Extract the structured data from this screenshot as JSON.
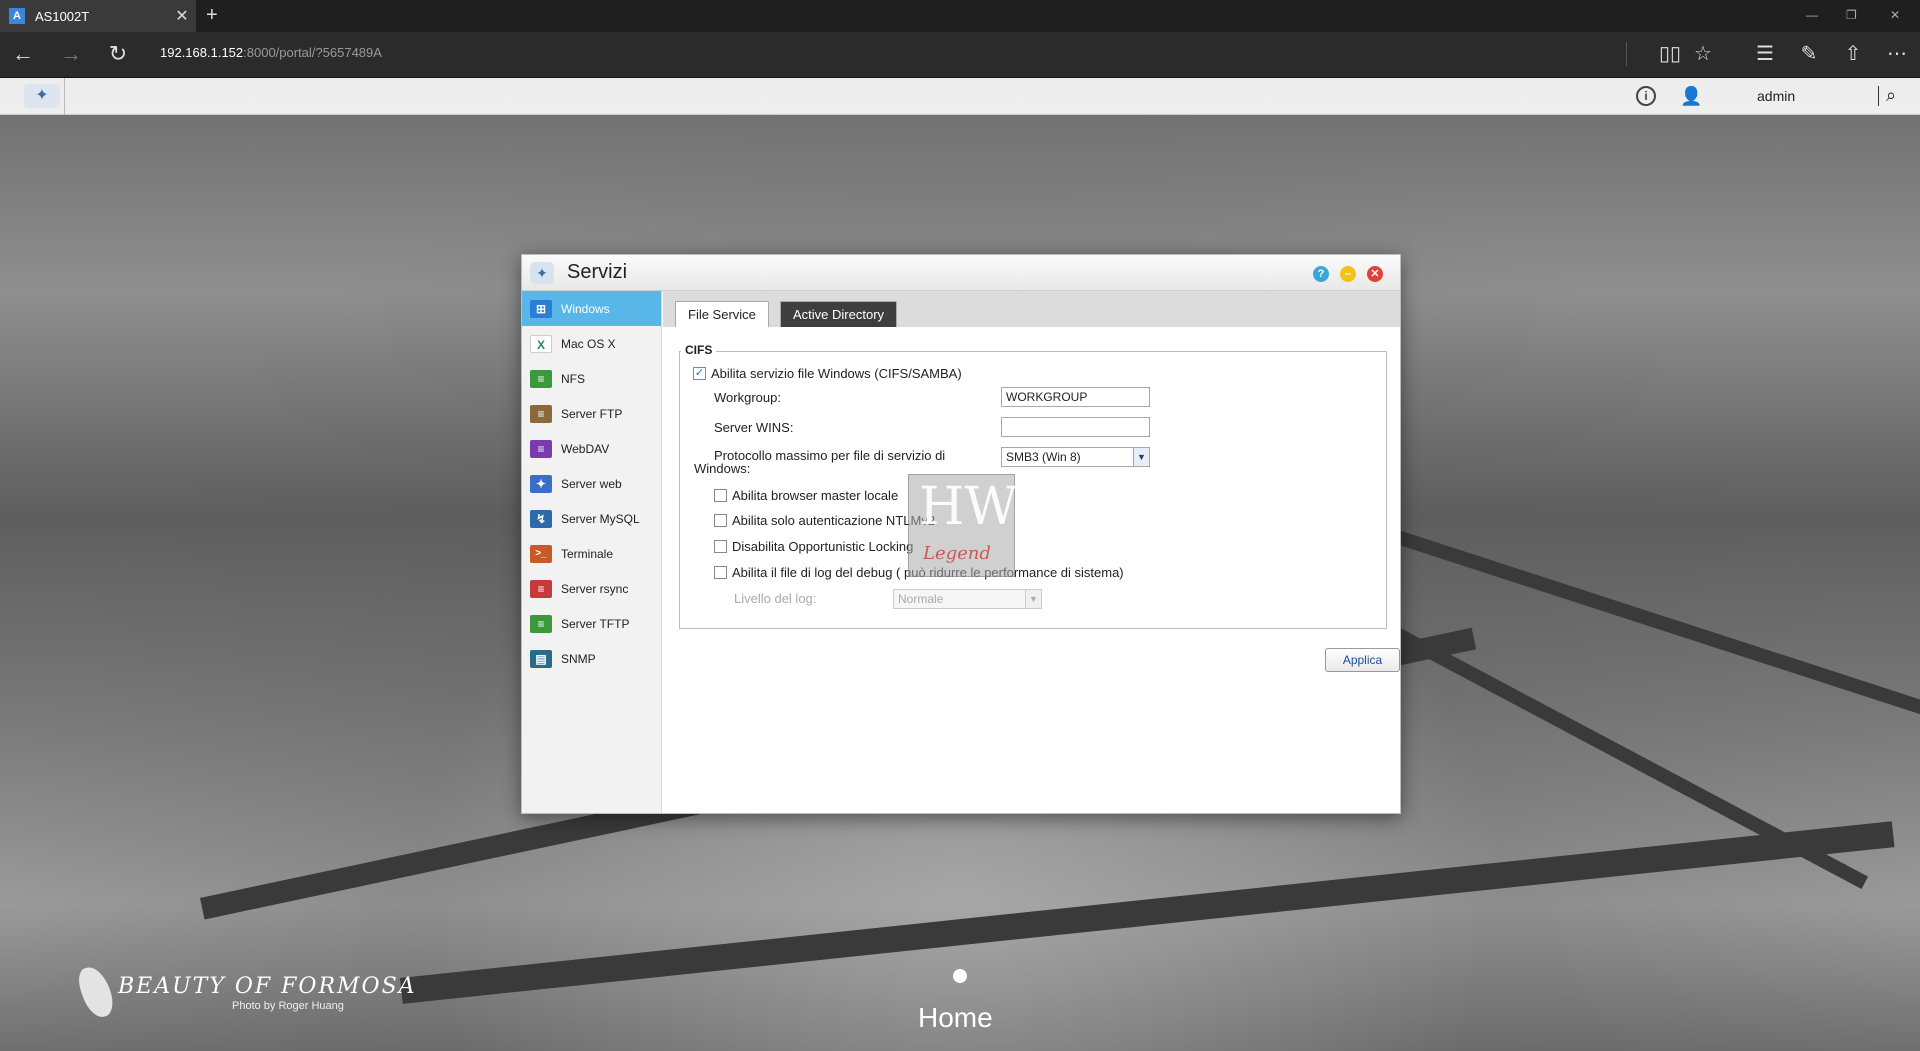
{
  "browser": {
    "tab_title": "AS1002T",
    "favicon_letter": "A",
    "url_host": "192.168.1.152",
    "url_rest": ":8000/portal/?5657489A"
  },
  "appbar": {
    "user_name": "admin"
  },
  "window": {
    "title": "Servizi",
    "sidebar": [
      {
        "label": "Windows",
        "icon": "windows-icon",
        "color": "#2a7fd4",
        "glyph": "⊞"
      },
      {
        "label": "Mac OS X",
        "icon": "macos-icon",
        "color": "#ffffff",
        "glyph": "X"
      },
      {
        "label": "NFS",
        "icon": "nfs-icon",
        "color": "#3a9a3a",
        "glyph": "≡"
      },
      {
        "label": "Server FTP",
        "icon": "ftp-icon",
        "color": "#8a6a3a",
        "glyph": "≡"
      },
      {
        "label": "WebDAV",
        "icon": "webdav-icon",
        "color": "#7a3ab0",
        "glyph": "≡"
      },
      {
        "label": "Server web",
        "icon": "web-server-icon",
        "color": "#3a6ec8",
        "glyph": "✦"
      },
      {
        "label": "Server MySQL",
        "icon": "mysql-icon",
        "color": "#2a6aa8",
        "glyph": "↯"
      },
      {
        "label": "Terminale",
        "icon": "terminal-icon",
        "color": "#c85a2a",
        "glyph": ">_"
      },
      {
        "label": "Server rsync",
        "icon": "rsync-icon",
        "color": "#c83a3a",
        "glyph": "≡"
      },
      {
        "label": "Server TFTP",
        "icon": "tftp-icon",
        "color": "#3a9a3a",
        "glyph": "≡"
      },
      {
        "label": "SNMP",
        "icon": "snmp-icon",
        "color": "#2a6a8a",
        "glyph": "▤"
      }
    ],
    "tabs": {
      "file_service": "File Service",
      "active_directory": "Active Directory"
    },
    "cifs": {
      "legend": "CIFS",
      "enable_label": "Abilita servizio file Windows (CIFS/SAMBA)",
      "enable_checked": "✓",
      "workgroup_label": "Workgroup:",
      "workgroup_value": "WORKGROUP",
      "wins_label": "Server WINS:",
      "wins_value": "",
      "protocol_label_1": "Protocollo massimo per file di servizio di",
      "protocol_label_2": "Windows:",
      "protocol_value": "SMB3 (Win 8)",
      "browser_master_label": "Abilita browser master locale",
      "ntlmv2_label": "Abilita solo autenticazione NTLMv2",
      "oplocks_label": "Disabilita Opportunistic Locking",
      "debug_log_label": "Abilita il file di log del debug ( può ridurre le performance di sistema)",
      "log_level_label": "Livello del log:",
      "log_level_value": "Normale"
    },
    "apply_label": "Applica"
  },
  "watermark": {
    "big": "HW",
    "small": "Legend"
  },
  "desktop": {
    "home_label": "Home",
    "brand": "BEAUTY OF FORMOSA",
    "brand_credit": "Photo by Roger Huang"
  }
}
